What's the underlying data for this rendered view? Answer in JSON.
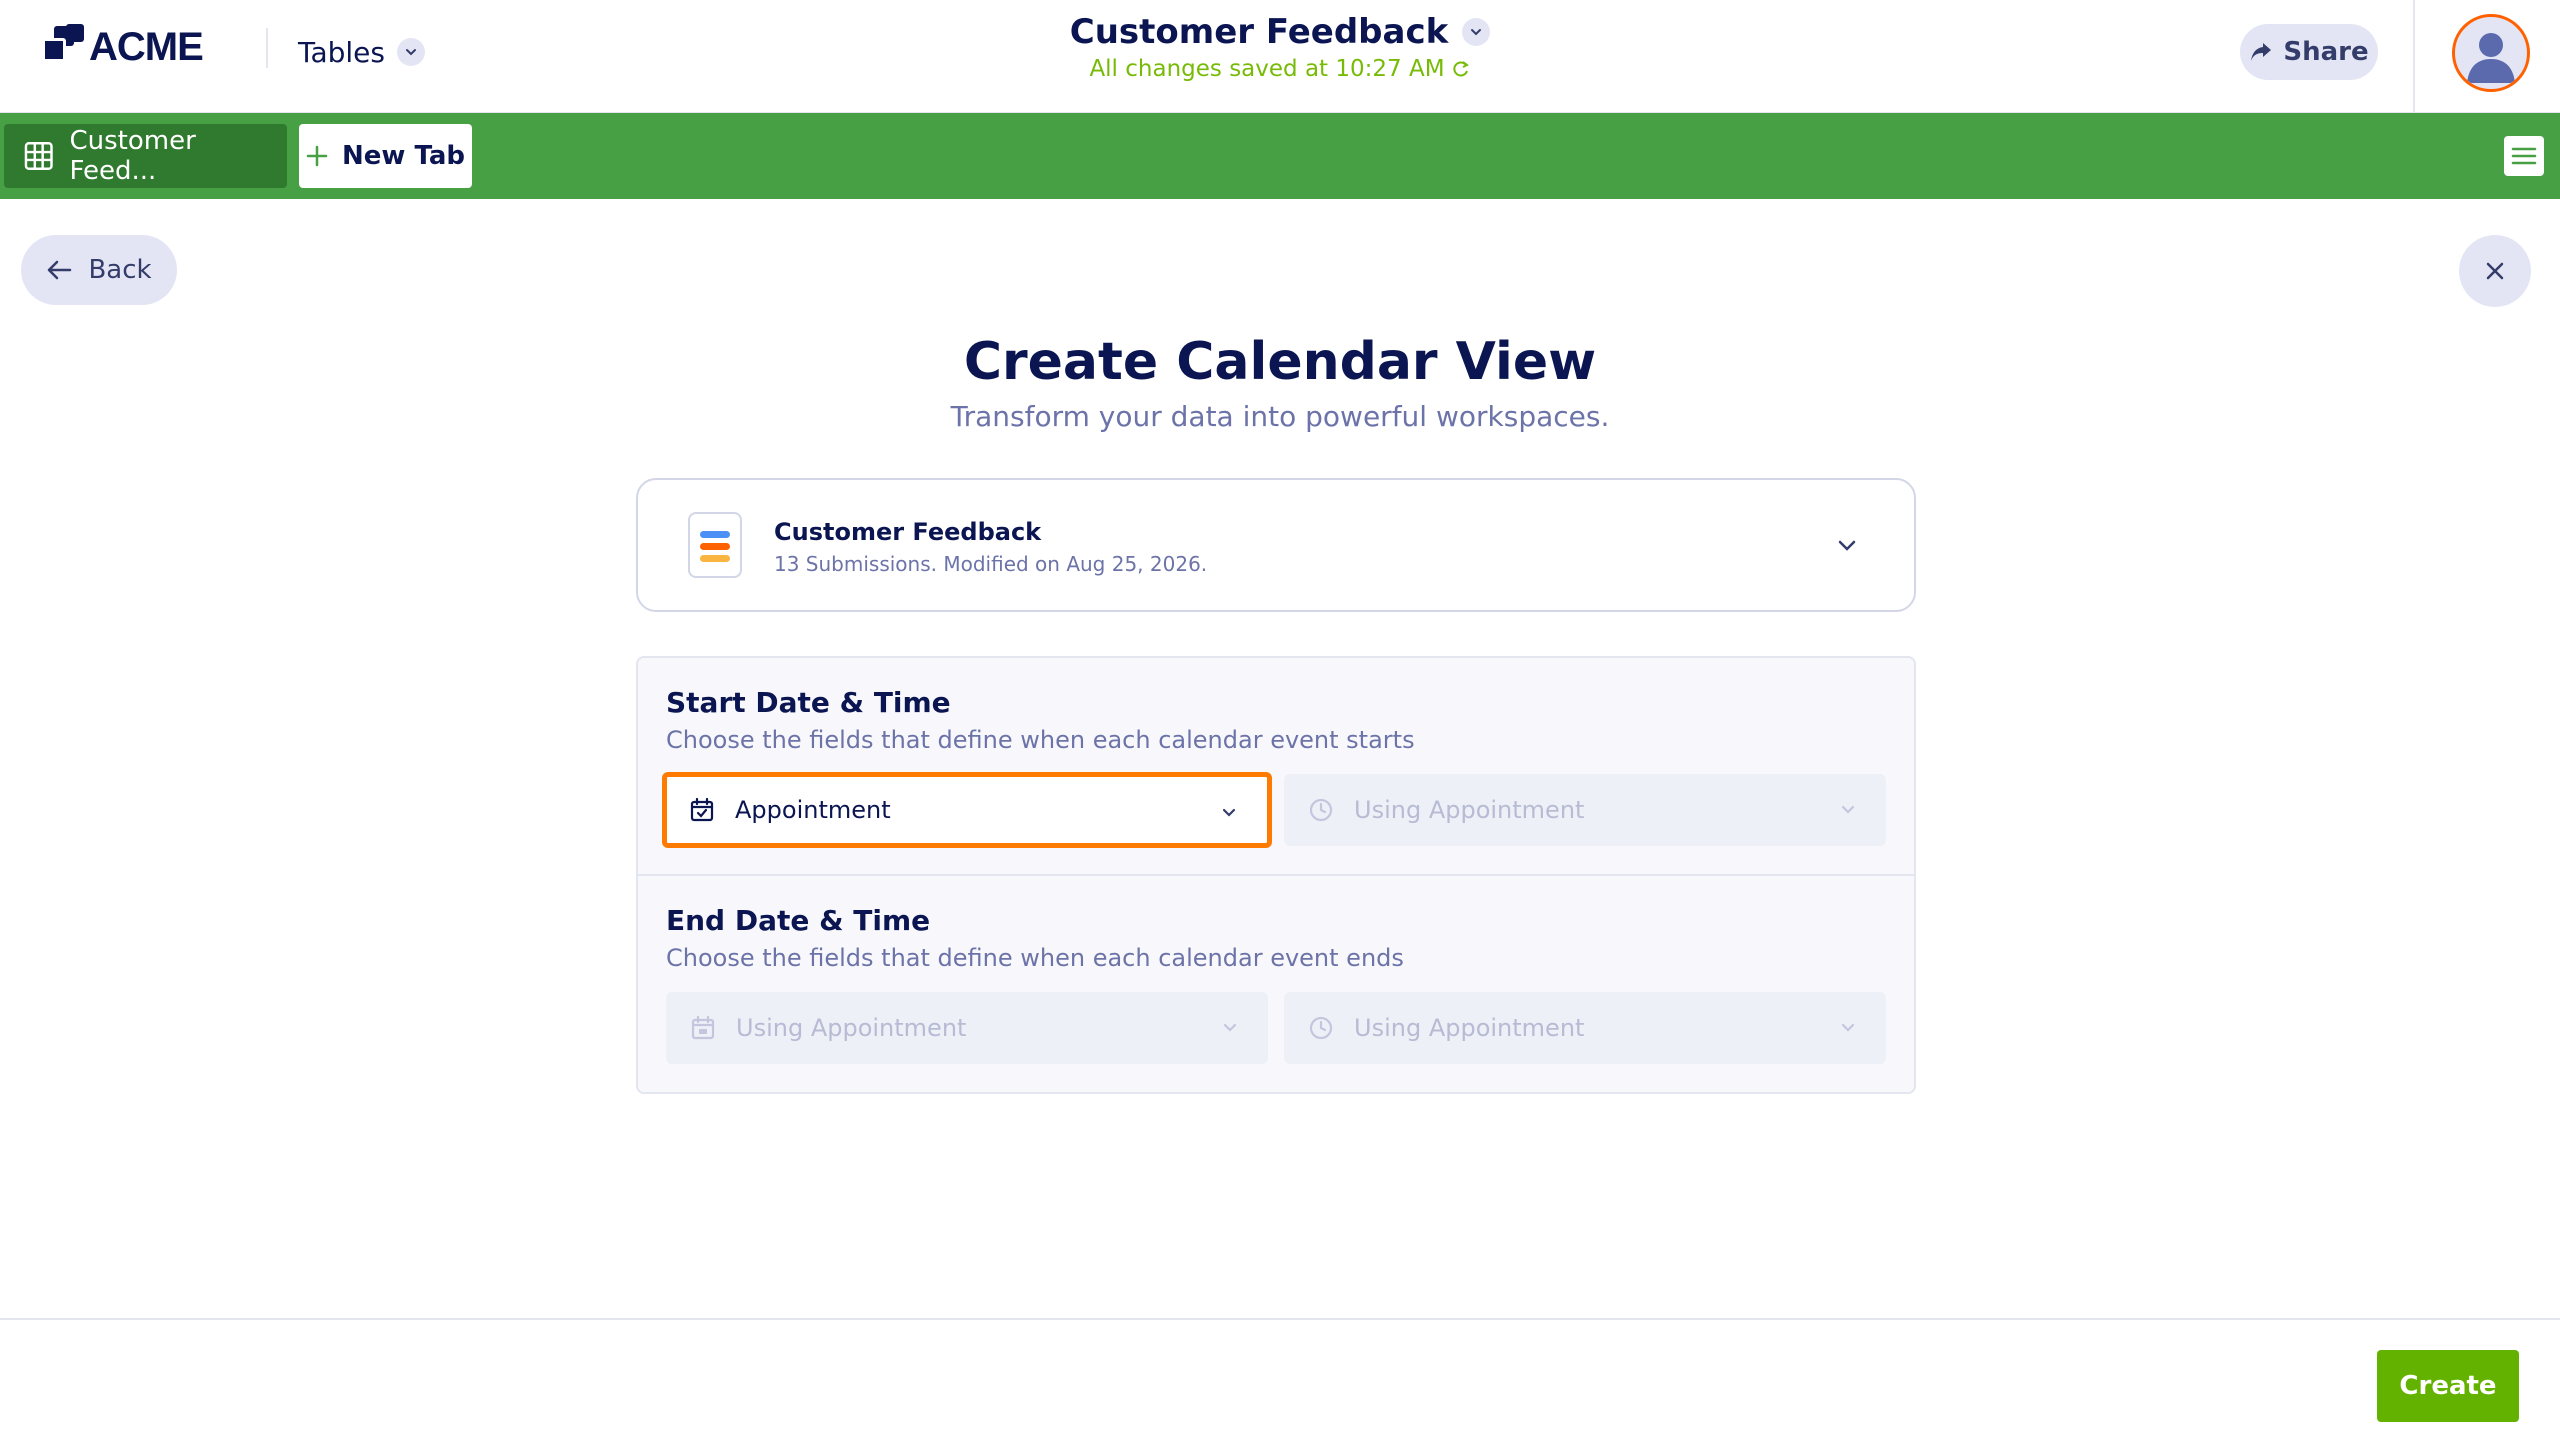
{
  "header": {
    "brand": "ACME",
    "product_switch_label": "Tables",
    "document_title": "Customer Feedback",
    "save_status": "All changes saved at 10:27 AM",
    "share_label": "Share"
  },
  "tabs": {
    "active_tab_label": "Customer Feed...",
    "new_tab_label": "New Tab"
  },
  "navigation": {
    "back_label": "Back"
  },
  "page": {
    "title": "Create Calendar View",
    "subtitle": "Transform your data into powerful workspaces."
  },
  "source": {
    "name": "Customer Feedback",
    "meta": "13 Submissions. Modified on Aug 25, 2026.",
    "icon_colors": [
      "#4a90f5",
      "#ff6100",
      "#f9b53f"
    ]
  },
  "start_section": {
    "title": "Start Date & Time",
    "description": "Choose the fields that define when each calendar event starts",
    "date_field": "Appointment",
    "time_field": "Using Appointment"
  },
  "end_section": {
    "title": "End Date & Time",
    "description": "Choose the fields that define when each calendar event ends",
    "date_field": "Using Appointment",
    "time_field": "Using Appointment"
  },
  "footer": {
    "create_label": "Create"
  },
  "colors": {
    "accent_green": "#48a044",
    "create_green": "#64b200",
    "highlight_orange": "#ff7a00",
    "navy": "#0a1551"
  }
}
